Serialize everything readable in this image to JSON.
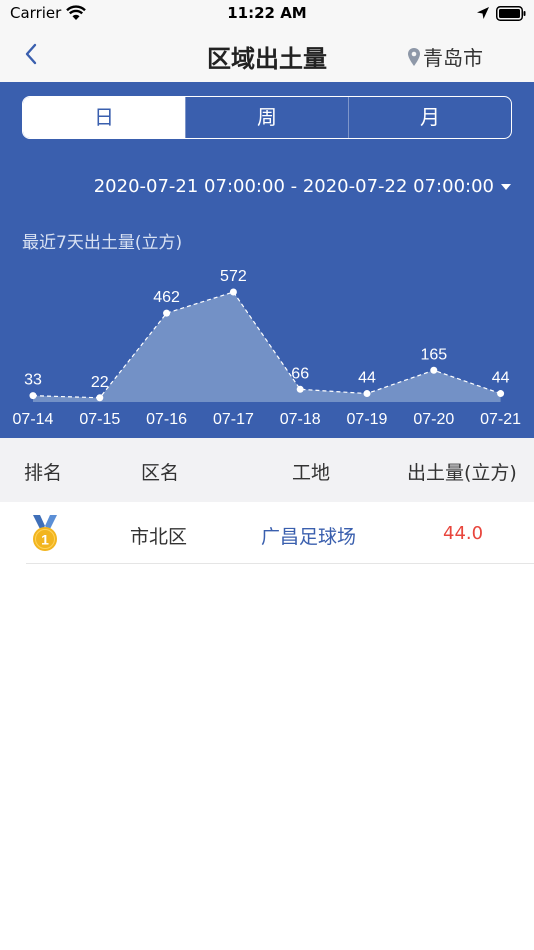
{
  "status_bar": {
    "carrier": "Carrier",
    "time": "11:22 AM"
  },
  "nav": {
    "title": "区域出土量",
    "city": "青岛市"
  },
  "tabs": [
    {
      "label": "日",
      "active": true
    },
    {
      "label": "周",
      "active": false
    },
    {
      "label": "月",
      "active": false
    }
  ],
  "date_range": "2020-07-21 07:00:00 - 2020-07-22 07:00:00",
  "chart_title": "最近7天出土量(立方)",
  "chart_data": {
    "type": "area",
    "title": "最近7天出土量(立方)",
    "categories": [
      "07-14",
      "07-15",
      "07-16",
      "07-17",
      "07-18",
      "07-19",
      "07-20",
      "07-21"
    ],
    "series": [
      {
        "values": [
          33,
          22,
          462,
          572,
          66,
          44,
          165,
          44
        ]
      }
    ],
    "value_labels": [
      "33",
      "22",
      "462",
      "572",
      "66",
      "44",
      "165",
      "44"
    ],
    "ylim": [
      0,
      572
    ],
    "grid": false,
    "colors": {
      "fill": "#7391c6",
      "line": "#ffffff",
      "background": "#3a5fae"
    }
  },
  "table": {
    "headers": {
      "rank": "排名",
      "district": "区名",
      "site": "工地",
      "volume": "出土量(立方)"
    },
    "rows": [
      {
        "rank": "1",
        "district": "市北区",
        "site": "广昌足球场",
        "volume": "44.0"
      }
    ]
  },
  "colors": {
    "accent": "#3a5fae",
    "volume_text": "#e8453c",
    "site_link": "#3a5fae"
  }
}
